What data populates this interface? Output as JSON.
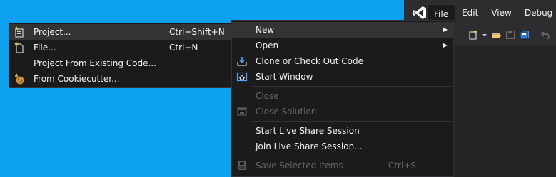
{
  "menubar": {
    "items": [
      "File",
      "Edit",
      "View",
      "Debug"
    ],
    "active": "File"
  },
  "file_menu": {
    "items": [
      {
        "label": "New",
        "shortcut": "",
        "submenu": true,
        "highlighted": true,
        "disabled": false,
        "icon": "none"
      },
      {
        "label": "Open",
        "shortcut": "",
        "submenu": true,
        "highlighted": false,
        "disabled": false,
        "icon": "none"
      },
      {
        "label": "Clone or Check Out Code",
        "shortcut": "",
        "submenu": false,
        "highlighted": false,
        "disabled": false,
        "icon": "clone-icon"
      },
      {
        "label": "Start Window",
        "shortcut": "",
        "submenu": false,
        "highlighted": false,
        "disabled": false,
        "icon": "start-window-icon"
      },
      {
        "label": "Close",
        "shortcut": "",
        "submenu": false,
        "highlighted": false,
        "disabled": true,
        "icon": "none"
      },
      {
        "label": "Close Solution",
        "shortcut": "",
        "submenu": false,
        "highlighted": false,
        "disabled": true,
        "icon": "close-solution-icon"
      },
      {
        "label": "Start Live Share Session",
        "shortcut": "",
        "submenu": false,
        "highlighted": false,
        "disabled": false,
        "icon": "none"
      },
      {
        "label": "Join Live Share Session...",
        "shortcut": "",
        "submenu": false,
        "highlighted": false,
        "disabled": false,
        "icon": "none"
      },
      {
        "label": "Save Selected Items",
        "shortcut": "Ctrl+S",
        "submenu": false,
        "highlighted": false,
        "disabled": true,
        "icon": "save-icon"
      }
    ]
  },
  "new_submenu": {
    "items": [
      {
        "label": "Project...",
        "shortcut": "Ctrl+Shift+N",
        "icon": "new-project-icon"
      },
      {
        "label": "File...",
        "shortcut": "Ctrl+N",
        "icon": "new-file-icon"
      },
      {
        "label": "Project From Existing Code...",
        "shortcut": "",
        "icon": "none"
      },
      {
        "label": "From Cookiecutter...",
        "shortcut": "",
        "icon": "cookiecutter-icon"
      }
    ]
  },
  "colors": {
    "desktop": "#0d9ff0",
    "menu_bg": "#1b1b1c",
    "highlight": "#333334",
    "text": "#f1f1f1",
    "disabled_text": "#656565",
    "vs_purple": "#865fc5"
  }
}
